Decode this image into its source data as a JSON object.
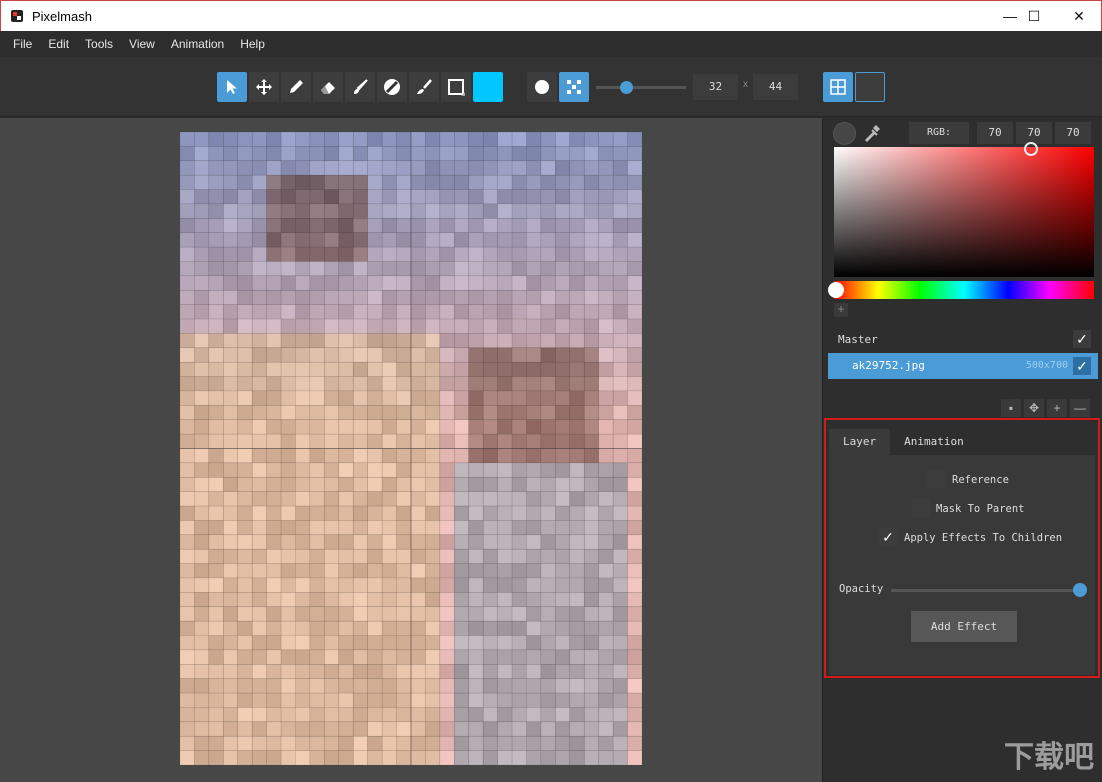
{
  "window": {
    "title": "Pixelmash",
    "controls": {
      "minimize": "—",
      "maximize": "☐",
      "close": "✕"
    }
  },
  "menu": [
    "File",
    "Edit",
    "Tools",
    "View",
    "Animation",
    "Help"
  ],
  "toolbar": {
    "tools": [
      "select-tool",
      "move-tool",
      "pencil-tool",
      "eraser-tool",
      "brush-tool",
      "fill-tool",
      "smudge-tool",
      "rectangle-tool"
    ],
    "active_tool": "select-tool",
    "current_color": "#00c8ff",
    "width": "32",
    "size_separator": "x",
    "height": "44"
  },
  "color_panel": {
    "mode_label": "RGB:",
    "r": "70",
    "g": "70",
    "b": "70",
    "add_swatch": "+"
  },
  "layers": {
    "master_label": "Master",
    "items": [
      {
        "name": "ak29752.jpg",
        "size": "500x700",
        "visible": true
      }
    ],
    "actions": [
      "copy-icon",
      "move-icon",
      "+",
      "—"
    ]
  },
  "properties": {
    "tabs": [
      "Layer",
      "Animation"
    ],
    "active_tab": "Layer",
    "reference_label": "Reference",
    "mask_label": "Mask To Parent",
    "apply_effects_label": "Apply Effects To Children",
    "opacity_label": "Opacity",
    "add_effect_label": "Add Effect"
  },
  "watermark": "下载吧",
  "colors": {
    "accent": "#4a9bd6",
    "highlight_border": "#d21b1b"
  }
}
